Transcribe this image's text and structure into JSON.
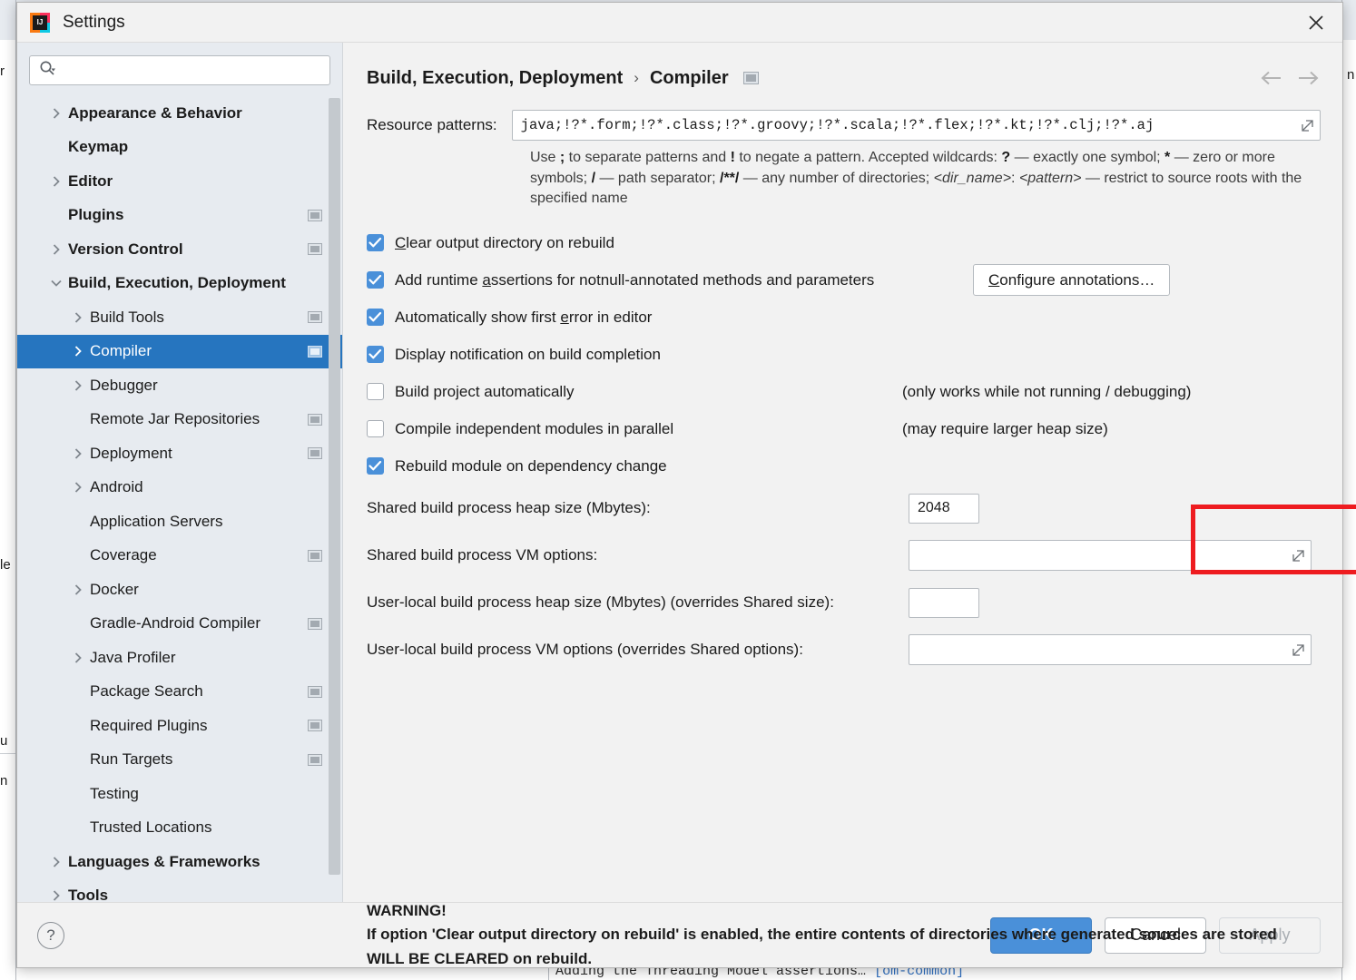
{
  "window": {
    "title": "Settings",
    "app_icon": "intellij-idea-logo-icon",
    "close_label": "✕"
  },
  "search": {
    "placeholder": "",
    "value": "",
    "icon": "search-icon"
  },
  "sidebar": {
    "items": [
      {
        "label": "Appearance & Behavior",
        "level": 0,
        "arrow": "collapsed",
        "badge": false,
        "selected": false
      },
      {
        "label": "Keymap",
        "level": 0,
        "arrow": "none",
        "badge": false,
        "selected": false
      },
      {
        "label": "Editor",
        "level": 0,
        "arrow": "collapsed",
        "badge": false,
        "selected": false
      },
      {
        "label": "Plugins",
        "level": 0,
        "arrow": "none",
        "badge": true,
        "selected": false
      },
      {
        "label": "Version Control",
        "level": 0,
        "arrow": "collapsed",
        "badge": true,
        "selected": false
      },
      {
        "label": "Build, Execution, Deployment",
        "level": 0,
        "arrow": "expanded",
        "badge": false,
        "selected": false
      },
      {
        "label": "Build Tools",
        "level": 1,
        "arrow": "collapsed",
        "badge": true,
        "selected": false
      },
      {
        "label": "Compiler",
        "level": 1,
        "arrow": "collapsed",
        "badge": true,
        "selected": true
      },
      {
        "label": "Debugger",
        "level": 1,
        "arrow": "collapsed",
        "badge": false,
        "selected": false
      },
      {
        "label": "Remote Jar Repositories",
        "level": 1,
        "arrow": "none",
        "badge": true,
        "selected": false
      },
      {
        "label": "Deployment",
        "level": 1,
        "arrow": "collapsed",
        "badge": true,
        "selected": false
      },
      {
        "label": "Android",
        "level": 1,
        "arrow": "collapsed",
        "badge": false,
        "selected": false
      },
      {
        "label": "Application Servers",
        "level": 1,
        "arrow": "none",
        "badge": false,
        "selected": false
      },
      {
        "label": "Coverage",
        "level": 1,
        "arrow": "none",
        "badge": true,
        "selected": false
      },
      {
        "label": "Docker",
        "level": 1,
        "arrow": "collapsed",
        "badge": false,
        "selected": false
      },
      {
        "label": "Gradle-Android Compiler",
        "level": 1,
        "arrow": "none",
        "badge": true,
        "selected": false
      },
      {
        "label": "Java Profiler",
        "level": 1,
        "arrow": "collapsed",
        "badge": false,
        "selected": false
      },
      {
        "label": "Package Search",
        "level": 1,
        "arrow": "none",
        "badge": true,
        "selected": false
      },
      {
        "label": "Required Plugins",
        "level": 1,
        "arrow": "none",
        "badge": true,
        "selected": false
      },
      {
        "label": "Run Targets",
        "level": 1,
        "arrow": "none",
        "badge": true,
        "selected": false
      },
      {
        "label": "Testing",
        "level": 1,
        "arrow": "none",
        "badge": false,
        "selected": false
      },
      {
        "label": "Trusted Locations",
        "level": 1,
        "arrow": "none",
        "badge": false,
        "selected": false
      },
      {
        "label": "Languages & Frameworks",
        "level": 0,
        "arrow": "collapsed",
        "badge": false,
        "selected": false
      },
      {
        "label": "Tools",
        "level": 0,
        "arrow": "collapsed",
        "badge": false,
        "selected": false
      }
    ]
  },
  "breadcrumb": {
    "root": "Build, Execution, Deployment",
    "separator": "›",
    "current": "Compiler",
    "badge_icon": "project-scope-badge-icon",
    "back_icon": "arrow-left-icon",
    "forward_icon": "arrow-right-icon"
  },
  "compiler": {
    "resource_patterns_label": "Resource patterns:",
    "resource_patterns_value": "java;!?*.form;!?*.class;!?*.groovy;!?*.scala;!?*.flex;!?*.kt;!?*.clj;!?*.aj",
    "resource_patterns_help": "Use ; to separate patterns and ! to negate a pattern. Accepted wildcards: ? — exactly one symbol; * — zero or more symbols; / — path separator; /**/ — any number of directories; <dir_name>: <pattern> — restrict to source roots with the specified name",
    "checkboxes": [
      {
        "label": "Clear output directory on rebuild",
        "mnemonic": "C",
        "checked": true,
        "note": "",
        "button": ""
      },
      {
        "label": "Add runtime assertions for notnull-annotated methods and parameters",
        "mnemonic": "a",
        "checked": true,
        "note": "",
        "button": "Configure annotations…"
      },
      {
        "label": "Automatically show first error in editor",
        "mnemonic": "e",
        "checked": true,
        "note": "",
        "button": ""
      },
      {
        "label": "Display notification on build completion",
        "mnemonic": "",
        "checked": true,
        "note": "",
        "button": ""
      },
      {
        "label": "Build project automatically",
        "mnemonic": "",
        "checked": false,
        "note": "(only works while not running / debugging)",
        "button": ""
      },
      {
        "label": "Compile independent modules in parallel",
        "mnemonic": "",
        "checked": false,
        "note": "(may require larger heap size)",
        "button": ""
      },
      {
        "label": "Rebuild module on dependency change",
        "mnemonic": "",
        "checked": true,
        "note": "",
        "button": ""
      }
    ],
    "fields": [
      {
        "label": "Shared build process heap size (Mbytes):",
        "value": "2048",
        "size": "small",
        "expandable": false
      },
      {
        "label": "Shared build process VM options:",
        "value": "",
        "size": "wide",
        "expandable": true
      },
      {
        "label": "User-local build process heap size (Mbytes) (overrides Shared size):",
        "value": "",
        "size": "small",
        "expandable": false
      },
      {
        "label": "User-local build process VM options (overrides Shared options):",
        "value": "",
        "size": "wide",
        "expandable": true
      }
    ],
    "warning_title": "WARNING!",
    "warning_body": "If option 'Clear output directory on rebuild' is enabled, the entire contents of directories where generated sources are stored WILL BE CLEARED on rebuild."
  },
  "annotation": {
    "color": "#ee1c20",
    "target": "shared-build-process-heap-size-field"
  },
  "footer": {
    "help_label": "?",
    "ok_label": "OK",
    "cancel_label": "Cancel",
    "apply_label": "Apply"
  },
  "background": {
    "console_line": "Adding the Threading Model assertions… ",
    "console_tag": "[om-common]",
    "console_tag_color": "#2f6fc0",
    "left_fragments": [
      "r",
      "le",
      "u",
      "n"
    ],
    "right_fragment": "n"
  }
}
